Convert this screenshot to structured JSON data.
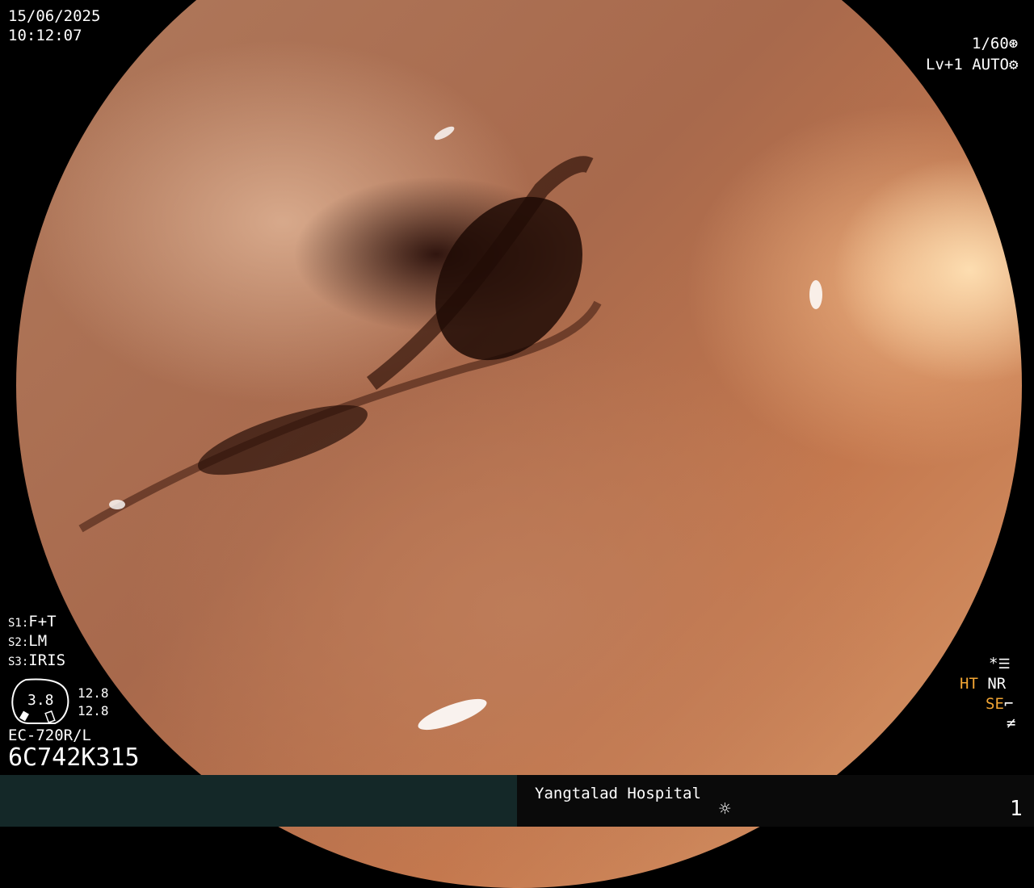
{
  "overlay": {
    "date": "15/06/2025",
    "time": "10:12:07",
    "shutter": "1/60",
    "level": "Lv+1",
    "iris_mode": "AUTO",
    "settings": {
      "s1_label": "S1:",
      "s1_value": "F+T",
      "s2_label": "S2:",
      "s2_value": "LM",
      "s3_label": "S3:",
      "s3_value": "IRIS"
    },
    "scale": {
      "center": "3.8",
      "top": "12.8",
      "bottom": "12.8"
    },
    "scope_model": "EC-720R/L",
    "serial": "6C742K315",
    "right_flags": {
      "star": "*",
      "ht": "HT",
      "nr": "NR",
      "se": "SE"
    }
  },
  "footer": {
    "hospital": "Yangtalad Hospital",
    "page": "1"
  },
  "colors": {
    "background": "#000000",
    "overlay_text": "#ffffff",
    "highlight": "#f3a634",
    "footer_left": "#142828",
    "footer_right": "#0a0a0a"
  }
}
